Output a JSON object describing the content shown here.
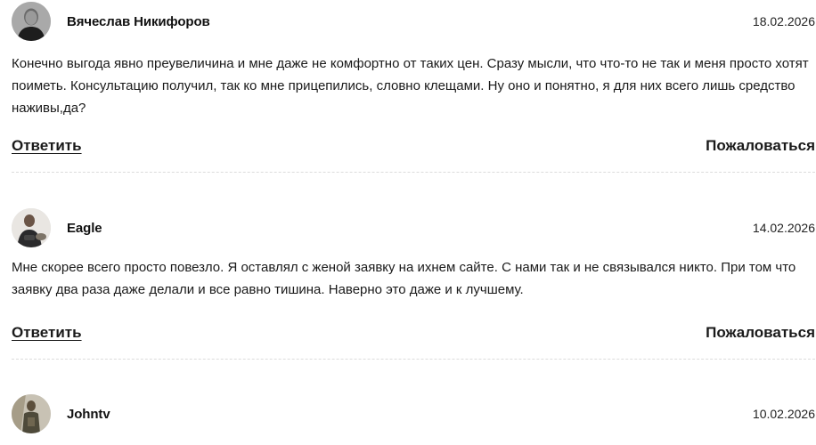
{
  "comments": [
    {
      "author": "Вячеслав Никифоров",
      "date": "18.02.2026",
      "text": "Конечно выгода явно преувеличина и мне даже не комфортно от таких цен. Сразу мысли, что что-то не так и меня просто хотят поиметь. Консультацию получил, так ко мне прицепились, словно клещами. Ну оно и понятно, я для них всего лишь средство наживы,да?",
      "reply_label": "Ответить",
      "report_label": "Пожаловаться"
    },
    {
      "author": "Eagle",
      "date": "14.02.2026",
      "text": "Мне скорее всего просто повезло. Я оставлял с женой заявку на ихнем сайте. С нами так и не связывался никто. При том что заявку два раза даже делали и все равно тишина. Наверно это даже и к лучшему.",
      "reply_label": "Ответить",
      "report_label": "Пожаловаться"
    },
    {
      "author": "Johntv",
      "date": "10.02.2026"
    }
  ]
}
